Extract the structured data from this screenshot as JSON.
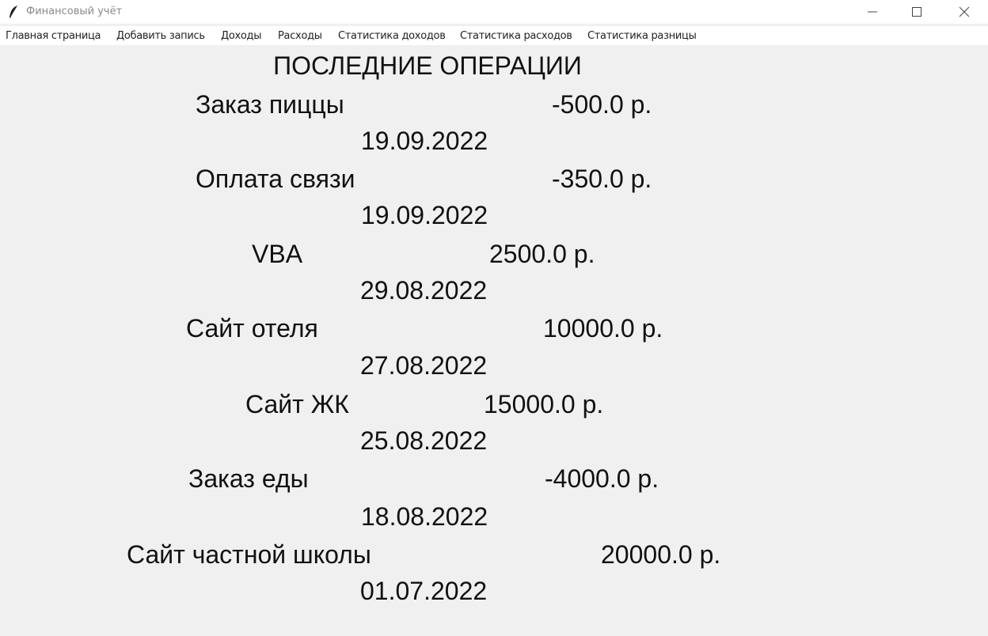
{
  "window": {
    "title": "Финансовый учёт"
  },
  "menu": [
    "Главная страница",
    "Добавить запись",
    "Доходы",
    "Расходы",
    "Статистика доходов",
    "Статистика расходов",
    "Статистика разницы"
  ],
  "main": {
    "heading": "ПОСЛЕДНИЕ ОПЕРАЦИИ",
    "operations": [
      {
        "name": "Заказ пиццы",
        "amount": "-500.0 р.",
        "date": "19.09.2022"
      },
      {
        "name": "Оплата связи",
        "amount": "-350.0 р.",
        "date": "19.09.2022"
      },
      {
        "name": "VBA",
        "amount": "2500.0 р.",
        "date": "29.08.2022"
      },
      {
        "name": "Сайт отеля",
        "amount": "10000.0 р.",
        "date": "27.08.2022"
      },
      {
        "name": "Сайт ЖК",
        "amount": "15000.0 р.",
        "date": "25.08.2022"
      },
      {
        "name": "Заказ еды",
        "amount": "-4000.0 р.",
        "date": "18.08.2022"
      },
      {
        "name": "Сайт частной школы",
        "amount": "20000.0 р.",
        "date": "01.07.2022"
      }
    ]
  }
}
